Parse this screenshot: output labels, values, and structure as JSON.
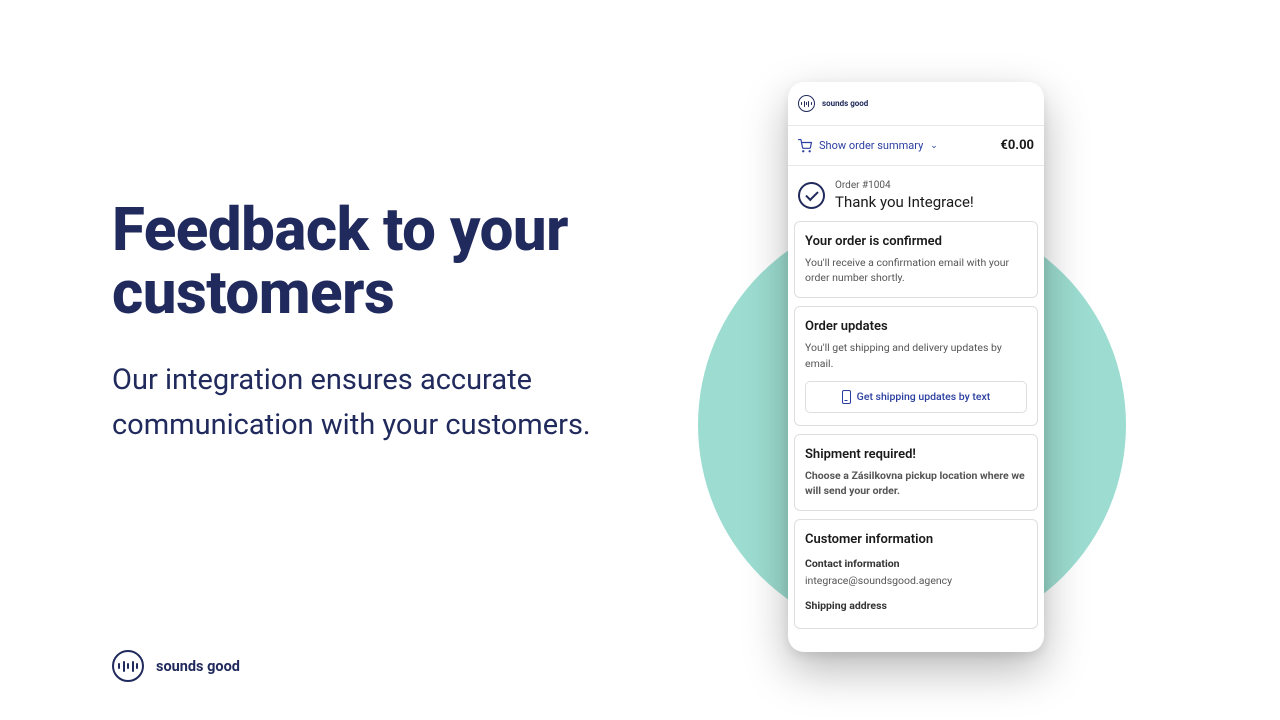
{
  "hero": {
    "headline": "Feedback to your customers",
    "subhead": "Our integration ensures accurate communication with your customers."
  },
  "brand": {
    "name": "sounds good"
  },
  "phone": {
    "brand": "sounds good",
    "summary": {
      "label": "Show order summary",
      "price": "€0.00"
    },
    "order": {
      "number": "Order #1004",
      "thank": "Thank you Integrace!"
    },
    "confirmed": {
      "title": "Your order is confirmed",
      "body": "You'll receive a confirmation email with your order number shortly."
    },
    "updates": {
      "title": "Order updates",
      "body": "You'll get shipping and delivery updates by email.",
      "button": "Get shipping updates by text"
    },
    "shipment": {
      "title": "Shipment required!",
      "note": "Choose a Zásilkovna pickup location where we will send your order."
    },
    "customer": {
      "title": "Customer information",
      "contact_label": "Contact information",
      "contact_value": "integrace@soundsgood.agency",
      "shipping_label": "Shipping address"
    }
  }
}
